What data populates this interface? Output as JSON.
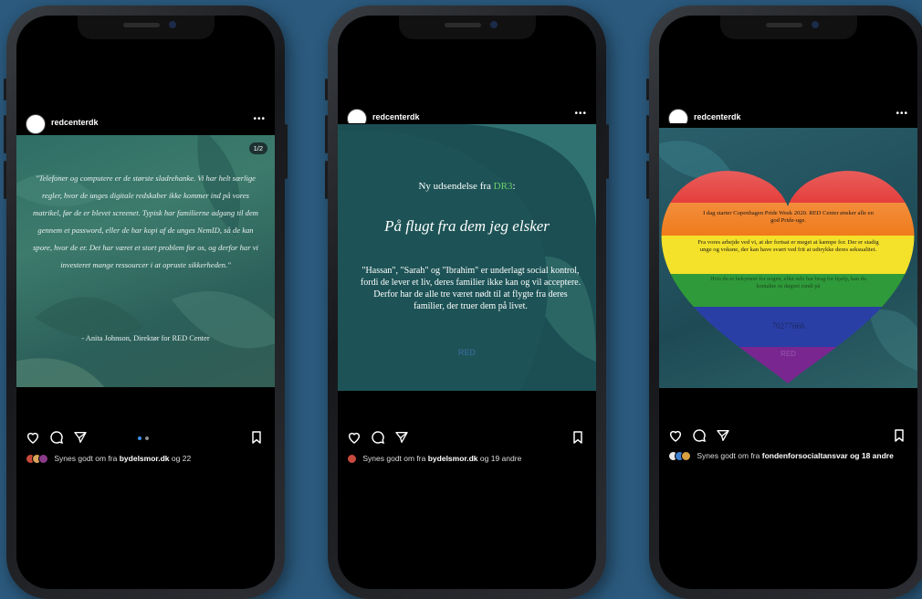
{
  "posts": [
    {
      "username": "redcenterdk",
      "counter": "1/2",
      "quote": "\"Telefoner og computere er de største sladrehanke. Vi har helt særlige regler, hvor de unges digitale redskaber ikke kommer ind på vores matrikel, før de er blevet screenet. Typisk har familierne adgang til dem gennem et password, eller de har kopi af de unges NemID, så de kan spore, hvor de er. Det har været et stort problem for os, og derfor har vi investeret mange ressourcer i at opruste sikkerheden.\"",
      "signature": "- Anita Johnson, Direktør for RED Center",
      "likes_prefix": "Synes godt om fra",
      "likes_user": "bydelsmor.dk",
      "likes_suffix": "og 22"
    },
    {
      "username": "redcenterdk",
      "announce_prefix": "Ny udsendelse fra",
      "announce_channel": "DR3",
      "announce_suffix": ":",
      "headline": "På flugt fra dem jeg elsker",
      "body": "\"Hassan\", \"Sarah\" og \"Ibrahim\" er underlagt social kontrol, fordi de lever et liv, deres familier ikke kan og vil acceptere. Derfor har de alle tre været nødt til at flygte fra deres familier, der truer dem på livet.",
      "logo": "RED",
      "likes_prefix": "Synes godt om fra",
      "likes_user": "bydelsmor.dk",
      "likes_suffix": "og 19 andre"
    },
    {
      "username": "redcenterdk",
      "heart_text_1": "I dag starter Copenhagen Pride Week 2020. RED Center ønsker alle en god Pride-uge.",
      "heart_text_2": "Fra vores arbejde ved vi, at der fortsat er meget at kæmpe for. Der er stadig unge og voksne, der kan have svært ved frit at udtrykke deres seksualitet.",
      "heart_text_3": "Hvis du er bekymret for nogen, eller selv har brug for hjælp, kan du kontakte os døgnet rundt på",
      "phone": "70277666",
      "logo": "RED",
      "likes_prefix": "Synes godt om fra",
      "likes_user": "fondenforsocialtansvar",
      "likes_suffix": "og 18 andre"
    }
  ],
  "colors": {
    "background": "#2b5a7e",
    "dr3_green": "#6fcf6a"
  }
}
